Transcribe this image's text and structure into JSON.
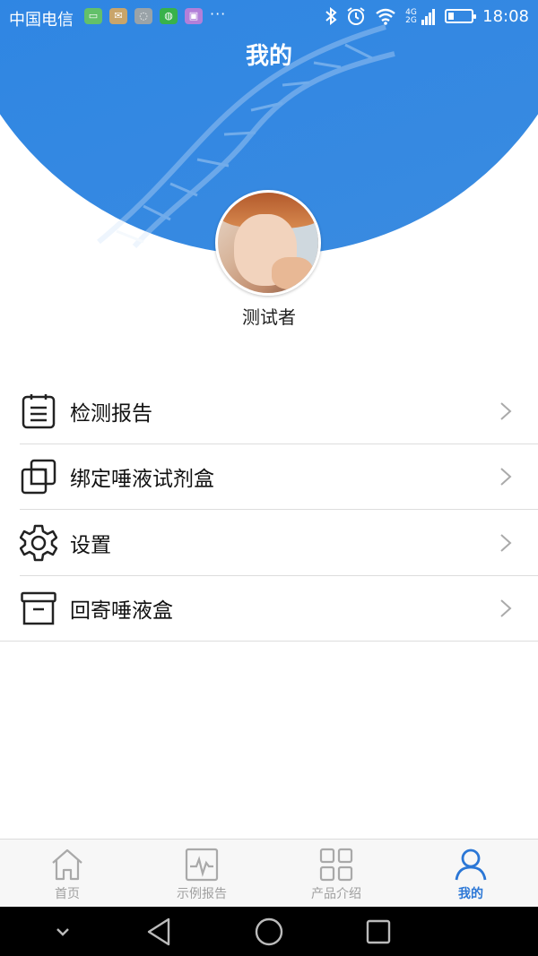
{
  "status_bar": {
    "carrier": "中国电信",
    "overflow": "···",
    "network": "4G 2G",
    "time": "18:08",
    "icons": [
      "notification-app-icon",
      "notification-app-icon",
      "message-icon",
      "wechat-icon",
      "gallery-icon",
      "bluetooth-icon",
      "alarm-icon",
      "wifi-icon",
      "signal-icon",
      "battery-icon"
    ]
  },
  "header": {
    "title": "我的",
    "background_color": "#3a8be2"
  },
  "profile": {
    "username": "测试者"
  },
  "menu": {
    "items": [
      {
        "label": "检测报告",
        "icon": "report-list-icon"
      },
      {
        "label": "绑定唾液试剂盒",
        "icon": "bind-kit-icon"
      },
      {
        "label": "设置",
        "icon": "gear-icon"
      },
      {
        "label": "回寄唾液盒",
        "icon": "archive-box-icon"
      }
    ]
  },
  "tabbar": {
    "tabs": [
      {
        "label": "首页",
        "icon": "home-icon",
        "active": false
      },
      {
        "label": "示例报告",
        "icon": "pulse-report-icon",
        "active": false
      },
      {
        "label": "产品介绍",
        "icon": "grid-icon",
        "active": false
      },
      {
        "label": "我的",
        "icon": "user-icon",
        "active": true
      }
    ],
    "active_color": "#2b77d6",
    "inactive_color": "#a0a0a0"
  }
}
